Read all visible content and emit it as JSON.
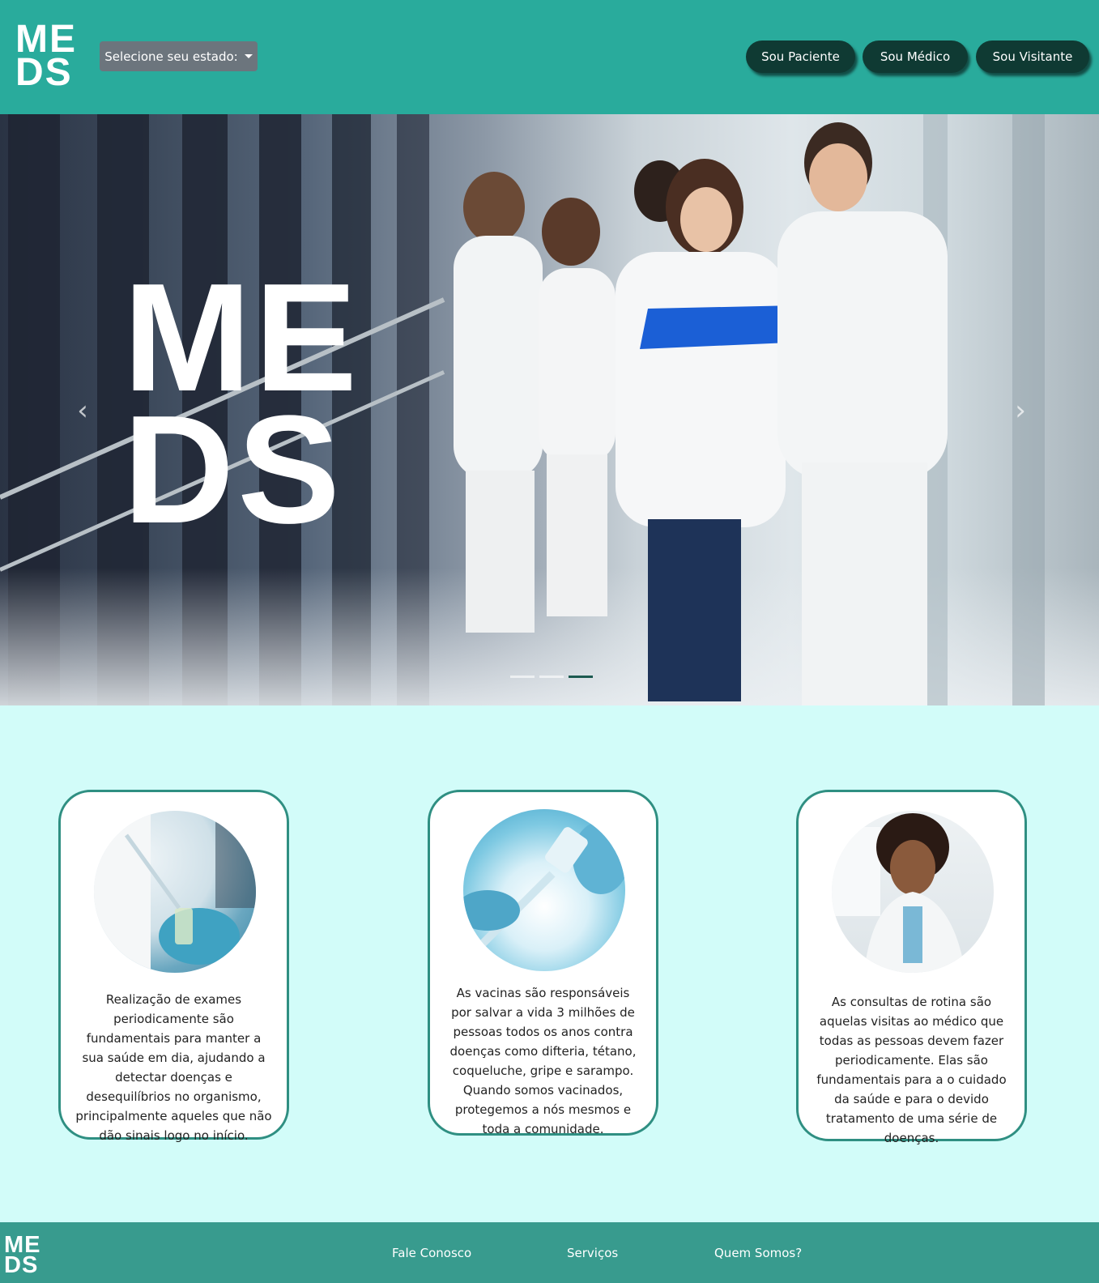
{
  "header": {
    "logo_line1": "ME",
    "logo_line2": "DS",
    "state_select_label": "Selecione seu estado:",
    "nav": [
      "Sou Paciente",
      "Sou Médico",
      "Sou Visitante"
    ]
  },
  "hero": {
    "logo_line1": "ME",
    "logo_line2": "DS",
    "prev_arrow": "‹",
    "next_arrow": "›",
    "slide_count": 3,
    "active_slide": 3
  },
  "cards": [
    {
      "text": "Realização de exames periodicamente são fundamentais para manter a sua saúde em dia, ajudando a detectar doenças e desequilíbrios no organismo, principalmente aqueles que não dão sinais logo no início.",
      "image": "lab-exam-photo"
    },
    {
      "text": "As vacinas são responsáveis por salvar a vida 3 milhões de pessoas todos os anos contra doenças como difteria, tétano, coqueluche, gripe e sarampo. Quando somos vacinados, protegemos a nós mesmos e toda a comunidade.",
      "image": "vaccine-photo"
    },
    {
      "text": "As consultas de rotina são aquelas visitas ao médico que todas as pessoas devem fazer periodicamente. Elas são fundamentais para a o cuidado da saúde e para o devido tratamento de uma série de doenças.",
      "image": "doctor-photo"
    }
  ],
  "footer": {
    "logo_line1": "ME",
    "logo_line2": "DS",
    "links": [
      "Fale Conosco",
      "Serviços",
      "Quem Somos?"
    ]
  },
  "colors": {
    "header_bg": "#29ab9c",
    "nav_button": "#0f3a33",
    "page_bg": "#d2fcf9",
    "card_border": "#2f8f82",
    "footer_bg": "#389b8e"
  }
}
